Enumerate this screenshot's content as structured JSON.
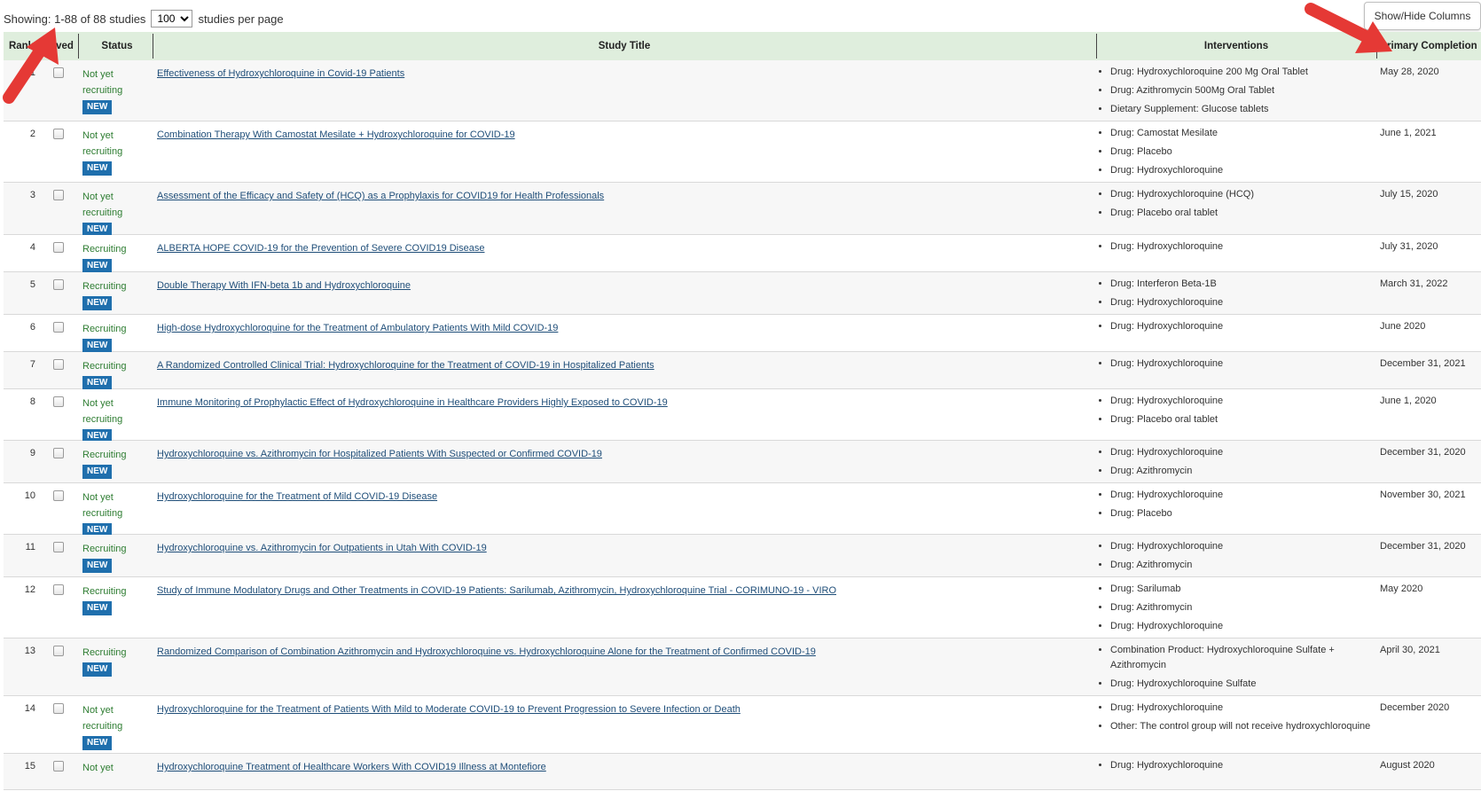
{
  "toolbar": {
    "showing_text": "Showing: 1-88 of 88 studies",
    "per_page_value": "100",
    "per_page_label": "studies per page",
    "show_hide_label": "Show/Hide Columns"
  },
  "columns": {
    "rank": "Rank",
    "saved": "Saved",
    "status": "Status",
    "title": "Study Title",
    "interventions": "Interventions",
    "primary_completion": "Primary Completion"
  },
  "colors": {
    "header_bg": "#dfeedd",
    "status_green": "#2e7d32",
    "badge_blue": "#1f6fad",
    "link": "#1f4e79",
    "arrow_red": "#e53935"
  },
  "rows": [
    {
      "rank": "1",
      "status": "Not yet recruiting",
      "badge": "NEW",
      "title": "Effectiveness of Hydroxychloroquine in Covid-19 Patients",
      "interventions": [
        "Drug: Hydroxychloroquine 200 Mg Oral Tablet",
        "Drug: Azithromycin 500Mg Oral Tablet",
        "Dietary Supplement: Glucose tablets"
      ],
      "completion": "May 28, 2020",
      "h": 68
    },
    {
      "rank": "2",
      "status": "Not yet recruiting",
      "badge": "NEW",
      "title": "Combination Therapy With Camostat Mesilate + Hydroxychloroquine for COVID-19",
      "interventions": [
        "Drug: Camostat Mesilate",
        "Drug: Placebo",
        "Drug: Hydroxychloroquine"
      ],
      "completion": "June 1, 2021",
      "h": 68
    },
    {
      "rank": "3",
      "status": "Not yet recruiting",
      "badge": "NEW",
      "title": "Assessment of the Efficacy and Safety of (HCQ) as a Prophylaxis for COVID19 for Health Professionals",
      "interventions": [
        "Drug: Hydroxychloroquine (HCQ)",
        "Drug: Placebo oral tablet"
      ],
      "completion": "July 15, 2020",
      "h": 58
    },
    {
      "rank": "4",
      "status": "Recruiting",
      "badge": "NEW",
      "title": "ALBERTA HOPE COVID-19 for the Prevention of Severe COVID19 Disease",
      "interventions": [
        "Drug: Hydroxychloroquine"
      ],
      "completion": "July 31, 2020",
      "h": 41
    },
    {
      "rank": "5",
      "status": "Recruiting",
      "badge": "NEW",
      "title": "Double Therapy With IFN-beta 1b and Hydroxychloroquine",
      "interventions": [
        "Drug: Interferon Beta-1B",
        "Drug: Hydroxychloroquine"
      ],
      "completion": "March 31, 2022",
      "h": 47
    },
    {
      "rank": "6",
      "status": "Recruiting",
      "badge": "NEW",
      "title": "High-dose Hydroxychloroquine for the Treatment of Ambulatory Patients With Mild COVID-19",
      "interventions": [
        "Drug: Hydroxychloroquine"
      ],
      "completion": "June 2020",
      "h": 41
    },
    {
      "rank": "7",
      "status": "Recruiting",
      "badge": "NEW",
      "title": "A Randomized Controlled Clinical Trial: Hydroxychloroquine for the Treatment of COVID-19 in Hospitalized Patients",
      "interventions": [
        "Drug: Hydroxychloroquine"
      ],
      "completion": "December 31, 2021",
      "h": 41
    },
    {
      "rank": "8",
      "status": "Not yet recruiting",
      "badge": "NEW",
      "title": "Immune Monitoring of Prophylactic Effect of Hydroxychloroquine in Healthcare Providers Highly Exposed to COVID-19",
      "interventions": [
        "Drug: Hydroxychloroquine",
        "Drug: Placebo oral tablet"
      ],
      "completion": "June 1, 2020",
      "h": 57
    },
    {
      "rank": "9",
      "status": "Recruiting",
      "badge": "NEW",
      "title": "Hydroxychloroquine vs. Azithromycin for Hospitalized Patients With Suspected or Confirmed COVID-19",
      "interventions": [
        "Drug: Hydroxychloroquine",
        "Drug: Azithromycin"
      ],
      "completion": "December 31, 2020",
      "h": 47
    },
    {
      "rank": "10",
      "status": "Not yet recruiting",
      "badge": "NEW",
      "title": "Hydroxychloroquine for the Treatment of Mild COVID-19 Disease",
      "interventions": [
        "Drug: Hydroxychloroquine",
        "Drug: Placebo"
      ],
      "completion": "November 30, 2021",
      "h": 57
    },
    {
      "rank": "11",
      "status": "Recruiting",
      "badge": "NEW",
      "title": "Hydroxychloroquine vs. Azithromycin for Outpatients in Utah With COVID-19",
      "interventions": [
        "Drug: Hydroxychloroquine",
        "Drug: Azithromycin"
      ],
      "completion": "December 31, 2020",
      "h": 47
    },
    {
      "rank": "12",
      "status": "Recruiting",
      "badge": "NEW",
      "title": "Study of Immune Modulatory Drugs and Other Treatments in COVID-19 Patients: Sarilumab, Azithromycin, Hydroxychloroquine Trial - CORIMUNO-19 - VIRO",
      "interventions": [
        "Drug: Sarilumab",
        "Drug: Azithromycin",
        "Drug: Hydroxychloroquine"
      ],
      "completion": "May 2020",
      "h": 68
    },
    {
      "rank": "13",
      "status": "Recruiting",
      "badge": "NEW",
      "title": "Randomized Comparison of Combination Azithromycin and Hydroxychloroquine vs. Hydroxychloroquine Alone for the Treatment of Confirmed COVID-19",
      "interventions": [
        "Combination Product: Hydroxychloroquine Sulfate + Azithromycin",
        "Drug: Hydroxychloroquine Sulfate"
      ],
      "completion": "April 30, 2021",
      "h": 64
    },
    {
      "rank": "14",
      "status": "Not yet recruiting",
      "badge": "NEW",
      "title": "Hydroxychloroquine for the Treatment of Patients With Mild to Moderate COVID-19 to Prevent Progression to Severe Infection or Death",
      "interventions": [
        "Drug: Hydroxychloroquine",
        "Other: The control group will not receive hydroxychloroquine"
      ],
      "completion": "December 2020",
      "h": 64
    },
    {
      "rank": "15",
      "status": "Not yet",
      "badge": "",
      "title": "Hydroxychloroquine Treatment of Healthcare Workers With COVID19 Illness at Montefiore",
      "interventions": [
        "Drug: Hydroxychloroquine"
      ],
      "completion": "August 2020",
      "h": 40
    }
  ]
}
